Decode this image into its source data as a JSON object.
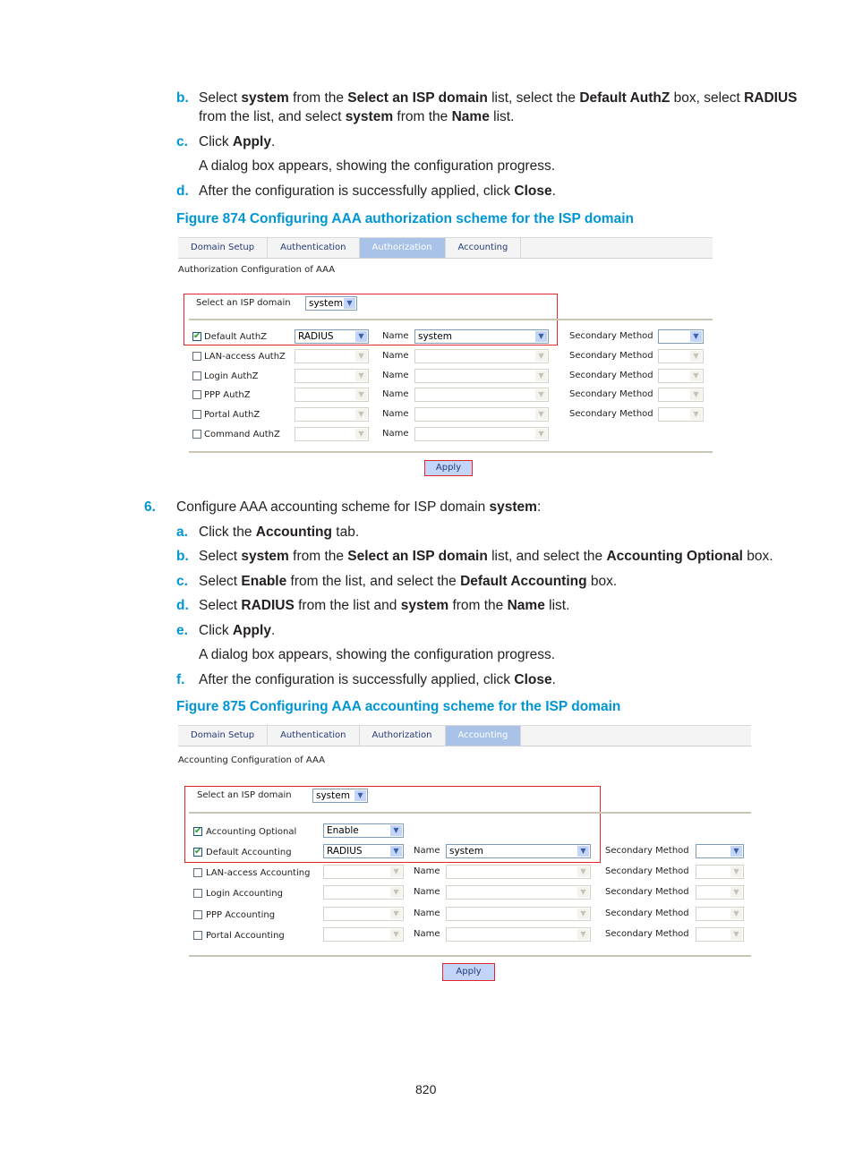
{
  "steps_top": [
    {
      "marker": "b.",
      "runs": [
        [
          "Select ",
          0
        ],
        [
          "system",
          1
        ],
        [
          " from the ",
          0
        ],
        [
          "Select an ISP domain",
          1
        ],
        [
          " list, select the ",
          0
        ],
        [
          "Default AuthZ",
          1
        ],
        [
          " box, select ",
          0
        ],
        [
          "RADIUS",
          1
        ]
      ]
    },
    {
      "marker": "",
      "runs": [
        [
          "from the list, and select ",
          0
        ],
        [
          "system",
          1
        ],
        [
          " from the ",
          0
        ],
        [
          "Name",
          1
        ],
        [
          " list.",
          0
        ]
      ]
    },
    {
      "marker": "c.",
      "runs": [
        [
          "Click ",
          0
        ],
        [
          "Apply",
          1
        ],
        [
          ".",
          0
        ]
      ]
    },
    {
      "marker": "",
      "runs": [
        [
          "A dialog box appears, showing the configuration progress.",
          0
        ]
      ]
    },
    {
      "marker": "d.",
      "runs": [
        [
          "After the configuration is successfully applied, click ",
          0
        ],
        [
          "Close",
          1
        ],
        [
          ".",
          0
        ]
      ]
    }
  ],
  "figure1": {
    "caption": "Figure 874 Configuring AAA authorization scheme for the ISP domain",
    "tabs": [
      "Domain Setup",
      "Authentication",
      "Authorization",
      "Accounting"
    ],
    "active_tab": 2,
    "section_title": "Authorization Configuration of AAA",
    "isp_label": "Select an ISP domain",
    "isp_value": "system",
    "name_label": "Name",
    "secondary_label": "Secondary Method",
    "rows": [
      {
        "label": "Default AuthZ",
        "checked": true,
        "method": "RADIUS",
        "name": "system",
        "secondary": true,
        "enabled": true
      },
      {
        "label": "LAN-access AuthZ",
        "checked": false,
        "method": "",
        "name": "",
        "secondary": true,
        "enabled": false
      },
      {
        "label": "Login AuthZ",
        "checked": false,
        "method": "",
        "name": "",
        "secondary": true,
        "enabled": false
      },
      {
        "label": "PPP AuthZ",
        "checked": false,
        "method": "",
        "name": "",
        "secondary": true,
        "enabled": false
      },
      {
        "label": "Portal AuthZ",
        "checked": false,
        "method": "",
        "name": "",
        "secondary": true,
        "enabled": false
      },
      {
        "label": "Command AuthZ",
        "checked": false,
        "method": "",
        "name": "",
        "secondary": false,
        "enabled": false
      }
    ],
    "apply_label": "Apply"
  },
  "steps_mid": [
    {
      "marker": "6.",
      "runs": [
        [
          "Configure AAA accounting scheme for ISP domain ",
          0
        ],
        [
          "system",
          1
        ],
        [
          ":",
          0
        ]
      ]
    },
    {
      "marker": "a.",
      "runs": [
        [
          "Click the ",
          0
        ],
        [
          "Accounting",
          1
        ],
        [
          " tab.",
          0
        ]
      ]
    },
    {
      "marker": "b.",
      "runs": [
        [
          "Select ",
          0
        ],
        [
          "system",
          1
        ],
        [
          " from the ",
          0
        ],
        [
          "Select an ISP domain",
          1
        ],
        [
          " list, and select the ",
          0
        ],
        [
          "Accounting Optional",
          1
        ],
        [
          " box.",
          0
        ]
      ]
    },
    {
      "marker": "c.",
      "runs": [
        [
          "Select ",
          0
        ],
        [
          "Enable",
          1
        ],
        [
          " from the list, and select the ",
          0
        ],
        [
          "Default Accounting",
          1
        ],
        [
          " box.",
          0
        ]
      ]
    },
    {
      "marker": "d.",
      "runs": [
        [
          "Select ",
          0
        ],
        [
          "RADIUS",
          1
        ],
        [
          " from the list and ",
          0
        ],
        [
          "system",
          1
        ],
        [
          " from the ",
          0
        ],
        [
          "Name",
          1
        ],
        [
          " list.",
          0
        ]
      ]
    },
    {
      "marker": "e.",
      "runs": [
        [
          "Click ",
          0
        ],
        [
          "Apply",
          1
        ],
        [
          ".",
          0
        ]
      ]
    },
    {
      "marker": "",
      "runs": [
        [
          "A dialog box appears, showing the configuration progress.",
          0
        ]
      ]
    },
    {
      "marker": "f.",
      "runs": [
        [
          "After the configuration is successfully applied, click ",
          0
        ],
        [
          "Close",
          1
        ],
        [
          ".",
          0
        ]
      ]
    }
  ],
  "figure2": {
    "caption": "Figure 875 Configuring AAA accounting scheme for the ISP domain",
    "tabs": [
      "Domain Setup",
      "Authentication",
      "Authorization",
      "Accounting"
    ],
    "active_tab": 3,
    "section_title": "Accounting Configuration of AAA",
    "isp_label": "Select an ISP domain",
    "isp_value": "system",
    "optional_label": "Accounting Optional",
    "optional_value": "Enable",
    "name_label": "Name",
    "secondary_label": "Secondary Method",
    "rows": [
      {
        "label": "Default Accounting",
        "checked": true,
        "method": "RADIUS",
        "name": "system",
        "enabled": true
      },
      {
        "label": "LAN-access Accounting",
        "checked": false,
        "method": "",
        "name": "",
        "enabled": false
      },
      {
        "label": "Login Accounting",
        "checked": false,
        "method": "",
        "name": "",
        "enabled": false
      },
      {
        "label": "PPP Accounting",
        "checked": false,
        "method": "",
        "name": "",
        "enabled": false
      },
      {
        "label": "Portal Accounting",
        "checked": false,
        "method": "",
        "name": "",
        "enabled": false
      }
    ],
    "apply_label": "Apply"
  },
  "page_number": "820"
}
